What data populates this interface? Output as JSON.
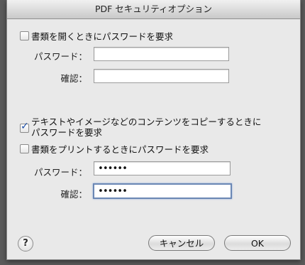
{
  "window": {
    "title": "PDF セキュリティオプション"
  },
  "open": {
    "require_label": "書類を開くときにパスワードを要求",
    "checked": false,
    "password_label": "パスワード：",
    "password_value": "",
    "confirm_label": "確認：",
    "confirm_value": ""
  },
  "copy": {
    "line1": "テキストやイメージなどのコンテンツをコピーするときに",
    "line2": "パスワードを要求",
    "checked": true
  },
  "print": {
    "label": "書類をプリントするときにパスワードを要求",
    "checked": false
  },
  "perm": {
    "password_label": "パスワード：",
    "password_value": "••••••",
    "confirm_label": "確認：",
    "confirm_value": "••••••"
  },
  "footer": {
    "help_label": "?",
    "cancel_label": "キャンセル",
    "ok_label": "OK"
  }
}
